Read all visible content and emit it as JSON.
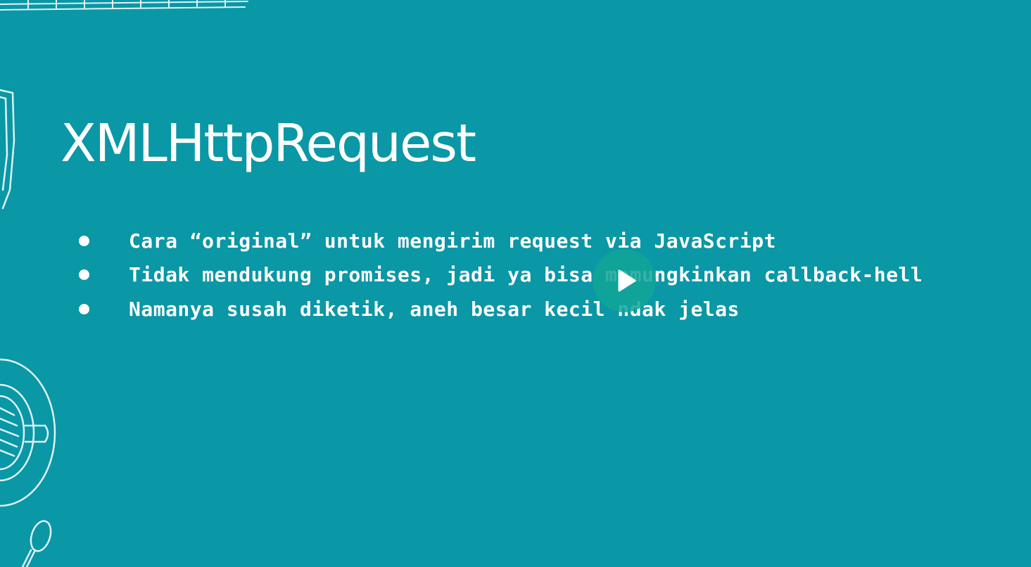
{
  "slide": {
    "title": "XMLHttpRequest",
    "bullets": [
      "Cara “original” untuk mengirim request via JavaScript",
      "Tidak mendukung promises, jadi ya bisa memungkinkan callback-hell",
      "Namanya susah diketik, aneh besar kecil ndak jelas"
    ]
  },
  "player": {
    "play_icon": "play-icon"
  },
  "colors": {
    "background": "#0a97a6",
    "text": "#ffffff",
    "play_button": "#12a596"
  },
  "decorations": [
    "keyboard-doodle",
    "monitor-doodle",
    "coffee-cup-doodle",
    "spoon-doodle"
  ]
}
